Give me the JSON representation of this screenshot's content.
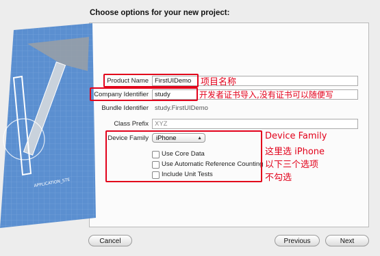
{
  "dialog": {
    "title": "Choose options for your new project:"
  },
  "form": {
    "product_name": {
      "label": "Product Name",
      "value": "FirstUIDemo"
    },
    "company_identifier": {
      "label": "Company Identifier",
      "value": "study"
    },
    "bundle_identifier": {
      "label": "Bundle Identifier",
      "value": "study.FirstUIDemo"
    },
    "class_prefix": {
      "label": "Class Prefix",
      "placeholder": "XYZ"
    },
    "device_family": {
      "label": "Device Family",
      "selected": "iPhone"
    },
    "checkboxes": [
      {
        "label": "Use Core Data",
        "checked": false
      },
      {
        "label": "Use Automatic Reference Counting",
        "checked": false
      },
      {
        "label": "Include Unit Tests",
        "checked": false
      }
    ]
  },
  "annotations": {
    "product_name": "项目名称",
    "company_identifier": "开发者证书导入,没有证书可以随便写",
    "device_family_lines": [
      "Device Family",
      "这里选 iPhone",
      "以下三个选项",
      "不勾选"
    ]
  },
  "buttons": {
    "cancel": "Cancel",
    "previous": "Previous",
    "next": "Next"
  },
  "art": {
    "blueprint_label": "APPLICATION_STE"
  },
  "colors": {
    "annotation_red": "#e2001a",
    "blueprint_blue": "#5b8fd0"
  }
}
